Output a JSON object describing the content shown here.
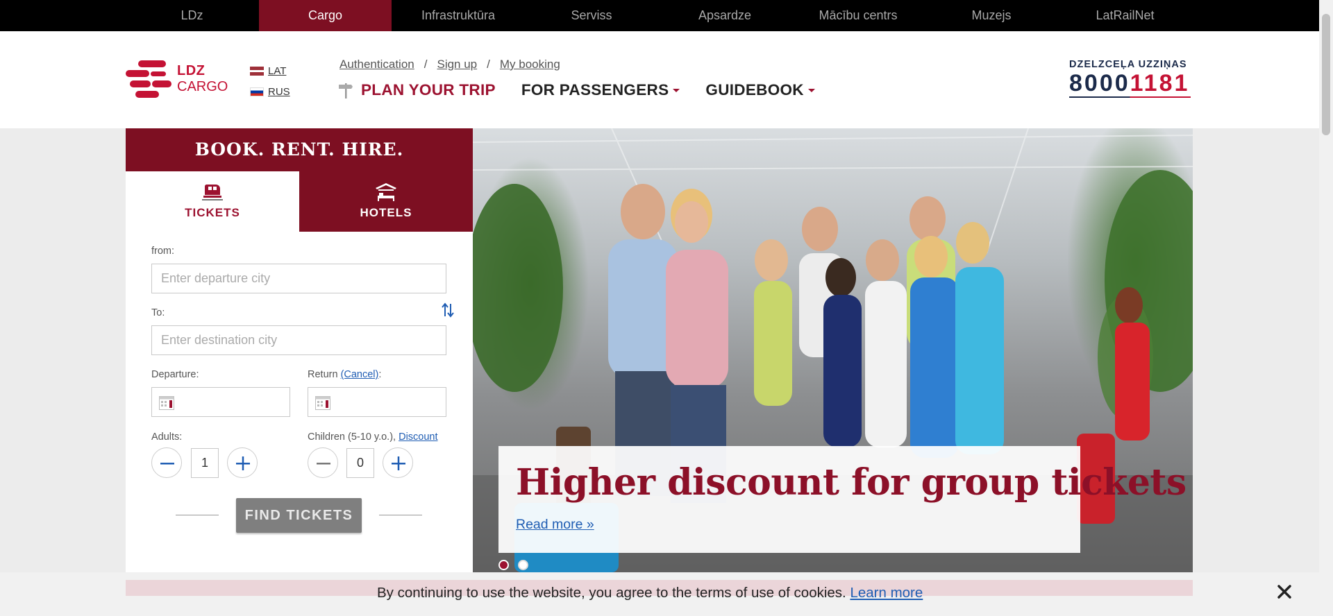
{
  "topnav": {
    "items": [
      "LDz",
      "Cargo",
      "Infrastruktūra",
      "Serviss",
      "Apsardze",
      "Mācību centrs",
      "Muzejs",
      "LatRailNet"
    ],
    "active": "Cargo"
  },
  "logo": {
    "line1": "LDZ",
    "line2": "CARGO"
  },
  "languages": {
    "lat": "LAT",
    "rus": "RUS"
  },
  "auth": {
    "authentication": "Authentication",
    "sep": "/",
    "signup": "Sign up",
    "mybooking": "My booking"
  },
  "nav": {
    "plan": "PLAN YOUR TRIP",
    "passengers": "FOR PASSENGERS",
    "guidebook": "GUIDEBOOK"
  },
  "hotline": {
    "title": "DZELZCEĻA UZZIŅAS",
    "num_a": "8000",
    "num_b": "1181"
  },
  "booking": {
    "heading": "BOOK. RENT. HIRE.",
    "tab_tickets": "TICKETS",
    "tab_hotels": "HOTELS",
    "from_label": "from:",
    "from_placeholder": "Enter departure city",
    "to_label": "To:",
    "to_placeholder": "Enter destination city",
    "departure_label": "Departure:",
    "return_label": "Return ",
    "return_cancel": "(Cancel)",
    "return_colon": ":",
    "adults_label": "Adults:",
    "adults_value": "1",
    "children_label": "Children (5-10 y.o.), ",
    "children_discount": "Discount",
    "children_value": "0",
    "find_button": "FIND TICKETS"
  },
  "hero": {
    "headline": "Higher discount for group tickets",
    "read_more": "Read more »",
    "slides": 2,
    "active_slide": 1
  },
  "cookie": {
    "text": "By continuing to use the website, you agree to the terms of use of cookies. ",
    "learn_more": "Learn more"
  },
  "colors": {
    "brand": "#7d0f22",
    "accent": "#9c1230",
    "link": "#1f5db3"
  }
}
